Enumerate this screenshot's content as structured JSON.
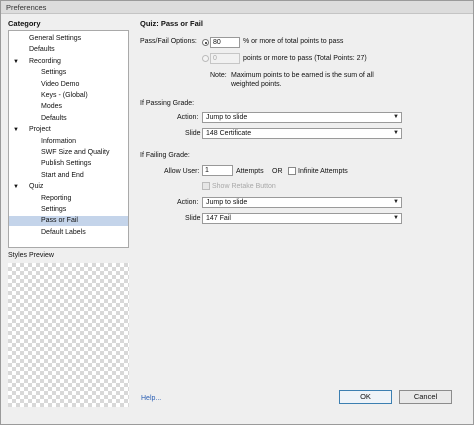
{
  "window": {
    "title": "Preferences"
  },
  "sidebar": {
    "heading": "Category",
    "items": [
      {
        "label": "General Settings",
        "level": 1,
        "expanded": null,
        "selected": false
      },
      {
        "label": "Defaults",
        "level": 1,
        "expanded": null,
        "selected": false
      },
      {
        "label": "Recording",
        "level": 1,
        "expanded": true,
        "selected": false
      },
      {
        "label": "Settings",
        "level": 2,
        "expanded": null,
        "selected": false
      },
      {
        "label": "Video Demo",
        "level": 2,
        "expanded": null,
        "selected": false
      },
      {
        "label": "Keys - (Global)",
        "level": 2,
        "expanded": null,
        "selected": false
      },
      {
        "label": "Modes",
        "level": 2,
        "expanded": null,
        "selected": false
      },
      {
        "label": "Defaults",
        "level": 2,
        "expanded": null,
        "selected": false
      },
      {
        "label": "Project",
        "level": 1,
        "expanded": true,
        "selected": false
      },
      {
        "label": "Information",
        "level": 2,
        "expanded": null,
        "selected": false
      },
      {
        "label": "SWF Size and Quality",
        "level": 2,
        "expanded": null,
        "selected": false
      },
      {
        "label": "Publish Settings",
        "level": 2,
        "expanded": null,
        "selected": false
      },
      {
        "label": "Start and End",
        "level": 2,
        "expanded": null,
        "selected": false
      },
      {
        "label": "Quiz",
        "level": 1,
        "expanded": true,
        "selected": false
      },
      {
        "label": "Reporting",
        "level": 2,
        "expanded": null,
        "selected": false
      },
      {
        "label": "Settings",
        "level": 2,
        "expanded": null,
        "selected": false
      },
      {
        "label": "Pass or Fail",
        "level": 2,
        "expanded": null,
        "selected": true
      },
      {
        "label": "Default Labels",
        "level": 2,
        "expanded": null,
        "selected": false
      }
    ],
    "expand_icon": "triangle-down-icon",
    "styles_preview_label": "Styles Preview"
  },
  "main": {
    "title": "Quiz: Pass or Fail",
    "pass_fail": {
      "label": "Pass/Fail Options:",
      "percent_option": {
        "value": "80",
        "suffix": "% or more of total points to pass",
        "selected": true
      },
      "points_option": {
        "value": "0",
        "suffix": "points or more to pass (Total Points: 27)",
        "selected": false,
        "disabled": true
      },
      "note_label": "Note:",
      "note_line1": "Maximum points to be earned is the sum of all",
      "note_line2": "weighted points."
    },
    "passing": {
      "heading": "If Passing Grade:",
      "action_label": "Action:",
      "action_value": "Jump to slide",
      "slide_label": "Slide",
      "slide_value": "148 Certificate"
    },
    "failing": {
      "heading": "If Failing Grade:",
      "allow_label": "Allow User:",
      "attempts_value": "1",
      "attempts_label": "Attempts",
      "or_label": "OR",
      "infinite_label": "Infinite Attempts",
      "infinite_checked": false,
      "retake_label": "Show Retake Button",
      "retake_checked": false,
      "retake_disabled": true,
      "action_label": "Action:",
      "action_value": "Jump to slide",
      "slide_label": "Slide",
      "slide_value": "147 Fail"
    },
    "dropdown_icon": "caret-down-icon"
  },
  "footer": {
    "help_link": "Help...",
    "ok_label": "OK",
    "cancel_label": "Cancel"
  },
  "colors": {
    "selection": "#c4d4ea",
    "link": "#2b5fb4",
    "default_button_border": "#3c7fb1"
  }
}
